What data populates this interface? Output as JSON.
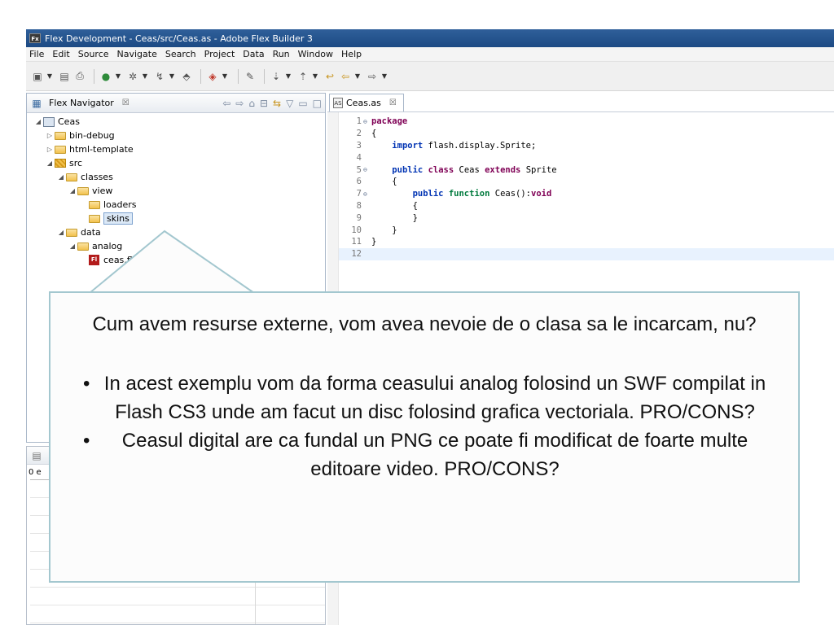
{
  "window": {
    "app_icon": "Fx",
    "title": "Flex Development - Ceas/src/Ceas.as - Adobe Flex Builder 3"
  },
  "menu": [
    "File",
    "Edit",
    "Source",
    "Navigate",
    "Search",
    "Project",
    "Data",
    "Run",
    "Window",
    "Help"
  ],
  "navigator": {
    "tab_title": "Flex Navigator",
    "close_glyph": "☒",
    "tree": [
      {
        "label": "Ceas",
        "icon": "project-folder-icon",
        "level": 0,
        "expanded": true
      },
      {
        "label": "bin-debug",
        "icon": "folder-icon",
        "level": 1,
        "expanded": false
      },
      {
        "label": "html-template",
        "icon": "folder-icon",
        "level": 1,
        "expanded": false
      },
      {
        "label": "src",
        "icon": "source-folder-icon",
        "level": 1,
        "expanded": true
      },
      {
        "label": "classes",
        "icon": "folder-icon",
        "level": 2,
        "expanded": true
      },
      {
        "label": "view",
        "icon": "folder-icon",
        "level": 3,
        "expanded": true
      },
      {
        "label": "loaders",
        "icon": "folder-icon",
        "level": 4
      },
      {
        "label": "skins",
        "icon": "folder-icon",
        "level": 4,
        "selected": true
      },
      {
        "label": "data",
        "icon": "folder-icon",
        "level": 2,
        "expanded": true
      },
      {
        "label": "analog",
        "icon": "folder-icon",
        "level": 3,
        "expanded": true
      },
      {
        "label": "ceas.fla",
        "icon": "fla-file-icon",
        "level": 4
      }
    ]
  },
  "bottom_panel": {
    "partial_text": "0 e"
  },
  "editor": {
    "tab_title": "Ceas.as",
    "close_glyph": "☒",
    "lines": [
      {
        "n": "1",
        "fold": "⊖",
        "segs": [
          {
            "t": "package",
            "c": "kw"
          }
        ]
      },
      {
        "n": "2",
        "fold": "",
        "segs": [
          {
            "t": "{",
            "c": ""
          }
        ]
      },
      {
        "n": "3",
        "fold": "",
        "segs": [
          {
            "t": "    ",
            "c": ""
          },
          {
            "t": "import",
            "c": "kw-blue"
          },
          {
            "t": " flash.display.Sprite;",
            "c": ""
          }
        ]
      },
      {
        "n": "4",
        "fold": "",
        "segs": []
      },
      {
        "n": "5",
        "fold": "⊖",
        "segs": [
          {
            "t": "    ",
            "c": ""
          },
          {
            "t": "public",
            "c": "kw-blue"
          },
          {
            "t": " ",
            "c": ""
          },
          {
            "t": "class",
            "c": "kw"
          },
          {
            "t": " Ceas ",
            "c": ""
          },
          {
            "t": "extends",
            "c": "kw"
          },
          {
            "t": " Sprite",
            "c": ""
          }
        ]
      },
      {
        "n": "6",
        "fold": "",
        "segs": [
          {
            "t": "    {",
            "c": ""
          }
        ]
      },
      {
        "n": "7",
        "fold": "⊖",
        "segs": [
          {
            "t": "        ",
            "c": ""
          },
          {
            "t": "public",
            "c": "kw-blue"
          },
          {
            "t": " ",
            "c": ""
          },
          {
            "t": "function",
            "c": "kw-green"
          },
          {
            "t": " Ceas():",
            "c": ""
          },
          {
            "t": "void",
            "c": "kw"
          }
        ]
      },
      {
        "n": "8",
        "fold": "",
        "segs": [
          {
            "t": "        {",
            "c": ""
          }
        ]
      },
      {
        "n": "9",
        "fold": "",
        "segs": [
          {
            "t": "        }",
            "c": ""
          }
        ]
      },
      {
        "n": "10",
        "fold": "",
        "segs": [
          {
            "t": "    }",
            "c": ""
          }
        ]
      },
      {
        "n": "11",
        "fold": "",
        "segs": [
          {
            "t": "}",
            "c": ""
          }
        ]
      },
      {
        "n": "12",
        "fold": "",
        "segs": [],
        "current": true
      }
    ]
  },
  "callout": {
    "question": "Cum avem resurse externe, vom avea nevoie de o clasa sa le incarcam, nu?",
    "bullet_glyph": "•",
    "bullets": [
      "In acest exemplu vom da forma ceasului analog folosind un SWF compilat in Flash CS3 unde am facut un disc folosind grafica vectoriala. PRO/CONS?",
      "Ceasul digital are ca fundal un PNG ce poate fi modificat de foarte multe editoare video. PRO/CONS?"
    ]
  },
  "colors": {
    "titlebar": "#1c4a84",
    "callout_border": "#a3c7cf",
    "keyword": "#7f0055",
    "keyword_blue": "#0033b3",
    "keyword_green": "#007a3d"
  }
}
